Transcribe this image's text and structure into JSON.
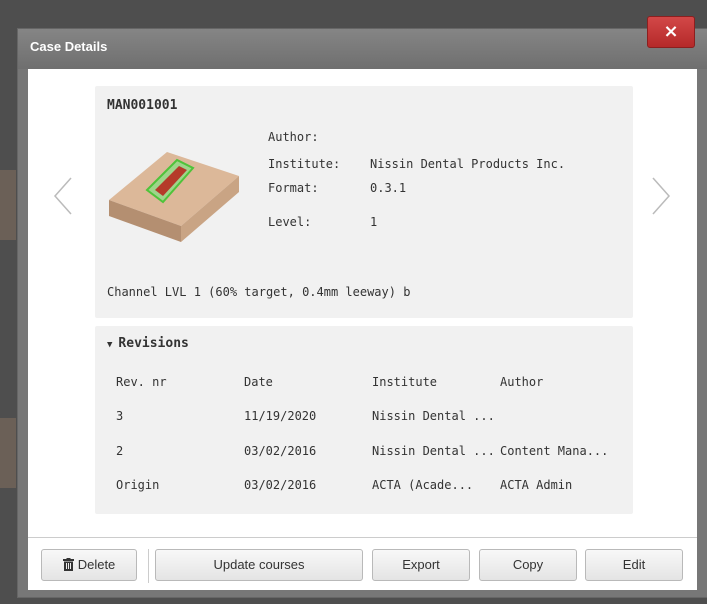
{
  "modal": {
    "title": "Case Details",
    "close_label": "×"
  },
  "case": {
    "id": "MAN001001",
    "fields": [
      {
        "label": "Author:",
        "value": ""
      },
      {
        "label": "Institute:",
        "value": "Nissin Dental Products Inc."
      },
      {
        "label": "Format:",
        "value": "0.3.1"
      },
      {
        "label": "Level:",
        "value": "1"
      }
    ],
    "description": "Channel LVL 1 (60% target, 0.4mm leeway) b"
  },
  "revisions": {
    "header": "Revisions",
    "toggle": "▼",
    "columns": [
      "Rev. nr",
      "Date",
      "Institute",
      "Author"
    ],
    "rows": [
      [
        "3",
        "11/19/2020",
        "Nissin Dental ...",
        ""
      ],
      [
        "2",
        "03/02/2016",
        "Nissin Dental ...",
        "Content Mana..."
      ],
      [
        "Origin",
        "03/02/2016",
        "ACTA (Acade...",
        "ACTA Admin"
      ]
    ]
  },
  "footer": {
    "delete": "Delete",
    "update_courses": "Update courses",
    "export": "Export",
    "copy": "Copy",
    "edit": "Edit"
  },
  "icons": {
    "prev": "chevron-left-icon",
    "next": "chevron-right-icon",
    "delete": "trash-icon",
    "close": "close-icon"
  }
}
